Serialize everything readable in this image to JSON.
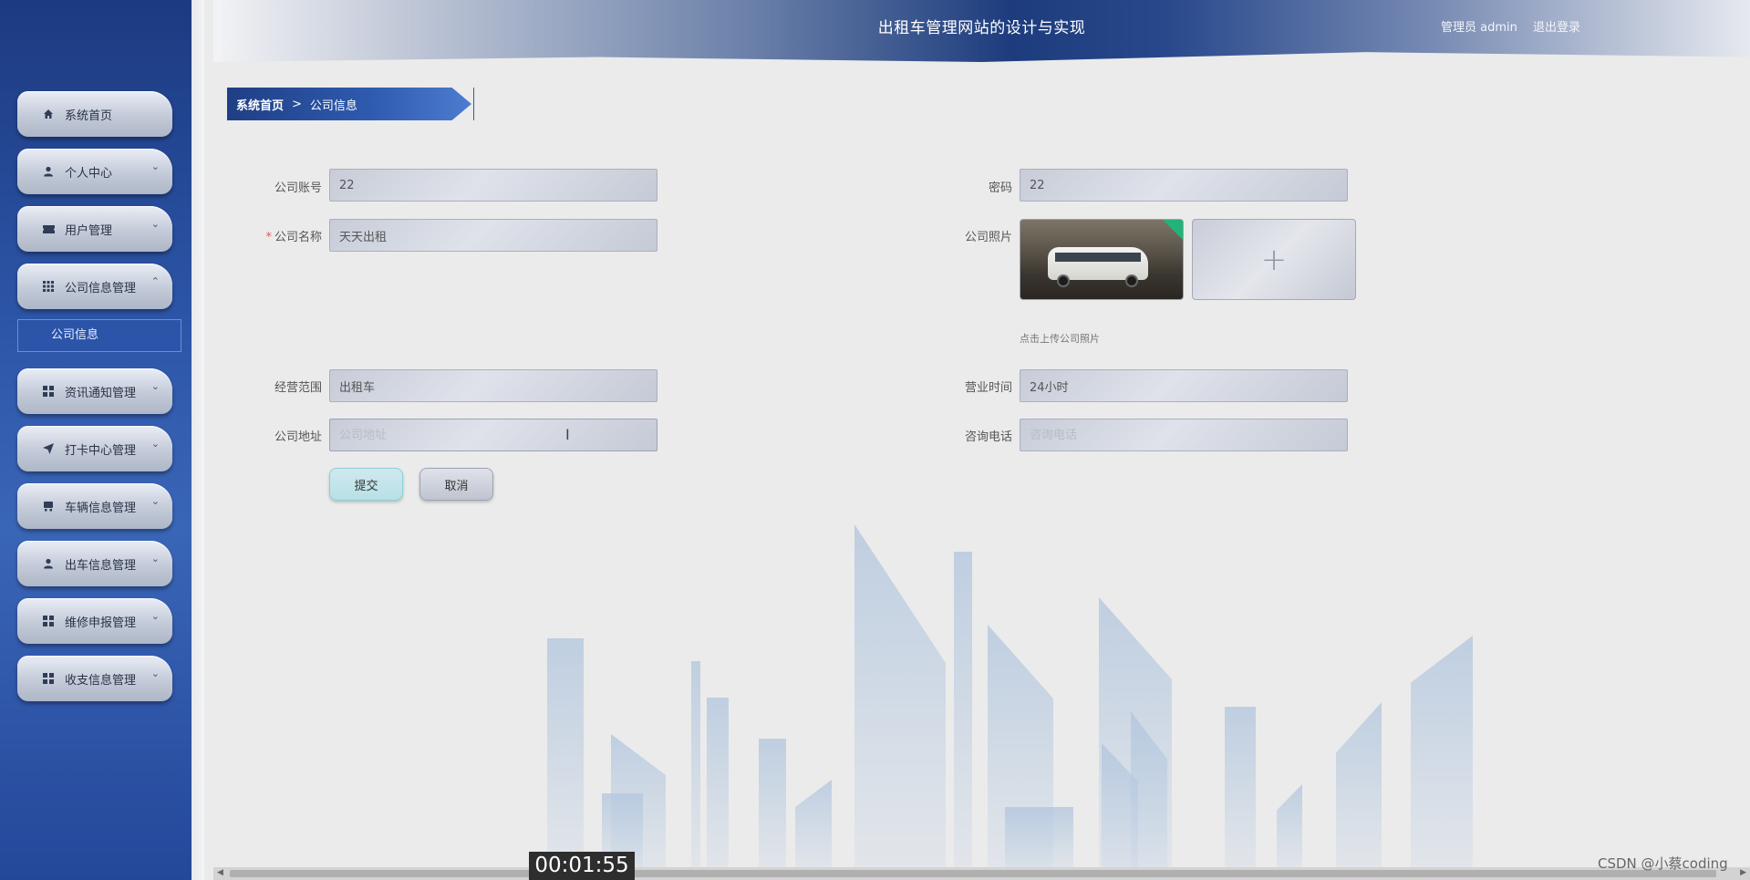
{
  "header": {
    "title": "出租车管理网站的设计与实现",
    "user": "管理员 admin",
    "logout": "退出登录"
  },
  "sidebar": {
    "items": [
      {
        "label": "系统首页",
        "icon": "home-icon",
        "expanded": null
      },
      {
        "label": "个人中心",
        "icon": "user-icon",
        "expanded": false
      },
      {
        "label": "用户管理",
        "icon": "ticket-icon",
        "expanded": false
      },
      {
        "label": "公司信息管理",
        "icon": "grid-icon",
        "expanded": true
      },
      {
        "label": "资讯通知管理",
        "icon": "grid-icon",
        "expanded": false
      },
      {
        "label": "打卡中心管理",
        "icon": "send-icon",
        "expanded": false
      },
      {
        "label": "车辆信息管理",
        "icon": "car-icon",
        "expanded": false
      },
      {
        "label": "出车信息管理",
        "icon": "user-icon",
        "expanded": false
      },
      {
        "label": "维修申报管理",
        "icon": "grid-icon",
        "expanded": false
      },
      {
        "label": "收支信息管理",
        "icon": "grid-icon",
        "expanded": false
      }
    ],
    "active_sub_item": "公司信息"
  },
  "breadcrumb": {
    "home": "系统首页",
    "separator": ">",
    "current": "公司信息"
  },
  "form": {
    "company_account": {
      "label": "公司账号",
      "value": "22"
    },
    "password": {
      "label": "密码",
      "value": "22"
    },
    "company_name": {
      "label": "公司名称",
      "value": "天天出租",
      "required": true
    },
    "company_photo": {
      "label": "公司照片",
      "hint": "点击上传公司照片"
    },
    "business_scope": {
      "label": "经营范围",
      "value": "出租车"
    },
    "business_hours": {
      "label": "营业时间",
      "value": "24小时"
    },
    "company_address": {
      "label": "公司地址",
      "value": "",
      "placeholder": "公司地址"
    },
    "phone": {
      "label": "咨询电话",
      "value": "",
      "placeholder": "咨询电话"
    },
    "submit_label": "提交",
    "cancel_label": "取消"
  },
  "overlay": {
    "timestamp": "00:01:55",
    "watermark": "CSDN @小蔡coding"
  },
  "colors": {
    "accent_blue": "#2c54a6",
    "submit_button": "#b8e0e6",
    "required_mark": "#e05a5a"
  }
}
